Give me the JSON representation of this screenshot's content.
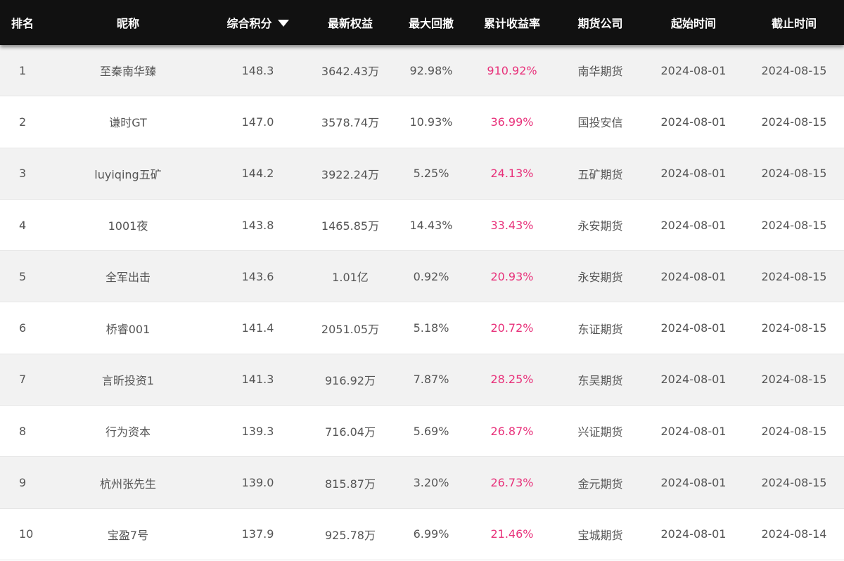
{
  "header": {
    "rank": "排名",
    "nickname": "昵称",
    "score": "综合积分",
    "equity": "最新权益",
    "max_drawdown": "最大回撤",
    "cum_return": "累计收益率",
    "company": "期货公司",
    "start_time": "起始时间",
    "end_time": "截止时间",
    "sort_icon": "triangle-down-icon"
  },
  "colors": {
    "header_bg": "#111111",
    "return_text": "#e8317a",
    "row_alt": "#f2f2f2"
  },
  "rows": [
    {
      "rank": "1",
      "nickname": "至秦南华臻",
      "score": "148.3",
      "equity": "3642.43万",
      "max_drawdown": "92.98%",
      "cum_return": "910.92%",
      "company": "南华期货",
      "start": "2024-08-01",
      "end": "2024-08-15"
    },
    {
      "rank": "2",
      "nickname": "谦时GT",
      "score": "147.0",
      "equity": "3578.74万",
      "max_drawdown": "10.93%",
      "cum_return": "36.99%",
      "company": "国投安信",
      "start": "2024-08-01",
      "end": "2024-08-15"
    },
    {
      "rank": "3",
      "nickname": "luyiqing五矿",
      "score": "144.2",
      "equity": "3922.24万",
      "max_drawdown": "5.25%",
      "cum_return": "24.13%",
      "company": "五矿期货",
      "start": "2024-08-01",
      "end": "2024-08-15"
    },
    {
      "rank": "4",
      "nickname": "1001夜",
      "score": "143.8",
      "equity": "1465.85万",
      "max_drawdown": "14.43%",
      "cum_return": "33.43%",
      "company": "永安期货",
      "start": "2024-08-01",
      "end": "2024-08-15"
    },
    {
      "rank": "5",
      "nickname": "全军出击",
      "score": "143.6",
      "equity": "1.01亿",
      "max_drawdown": "0.92%",
      "cum_return": "20.93%",
      "company": "永安期货",
      "start": "2024-08-01",
      "end": "2024-08-15"
    },
    {
      "rank": "6",
      "nickname": "桥睿001",
      "score": "141.4",
      "equity": "2051.05万",
      "max_drawdown": "5.18%",
      "cum_return": "20.72%",
      "company": "东证期货",
      "start": "2024-08-01",
      "end": "2024-08-15"
    },
    {
      "rank": "7",
      "nickname": "言昕投资1",
      "score": "141.3",
      "equity": "916.92万",
      "max_drawdown": "7.87%",
      "cum_return": "28.25%",
      "company": "东吴期货",
      "start": "2024-08-01",
      "end": "2024-08-15"
    },
    {
      "rank": "8",
      "nickname": "行为资本",
      "score": "139.3",
      "equity": "716.04万",
      "max_drawdown": "5.69%",
      "cum_return": "26.87%",
      "company": "兴证期货",
      "start": "2024-08-01",
      "end": "2024-08-15"
    },
    {
      "rank": "9",
      "nickname": "杭州张先生",
      "score": "139.0",
      "equity": "815.87万",
      "max_drawdown": "3.20%",
      "cum_return": "26.73%",
      "company": "金元期货",
      "start": "2024-08-01",
      "end": "2024-08-15"
    },
    {
      "rank": "10",
      "nickname": "宝盈7号",
      "score": "137.9",
      "equity": "925.78万",
      "max_drawdown": "6.99%",
      "cum_return": "21.46%",
      "company": "宝城期货",
      "start": "2024-08-01",
      "end": "2024-08-14"
    }
  ]
}
